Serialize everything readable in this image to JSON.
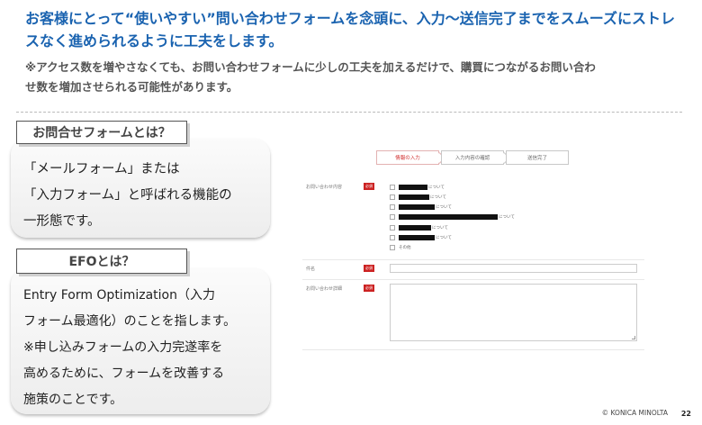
{
  "headline": [
    "お客様にとって“使いやすい”問い合わせフォームを念頭に、入力～送信完了までをスムーズにストレ",
    "スなく進められるように工夫をします。"
  ],
  "subline": [
    "※アクセス数を増やさなくても、お問い合わせフォームに少しの工夫を加えるだけで、購買につながるお問い合わ",
    "せ数を増加させられる可能性があります。"
  ],
  "sections": [
    {
      "label": "お問合せフォームとは？",
      "lines": [
        "「メールフォーム」または",
        "「入力フォーム」と呼ばれる機能の",
        "一形態です。"
      ]
    },
    {
      "label": "EFOとは？",
      "lines": [
        "Entry Form Optimization（入力",
        "フォーム最適化）のことを指します。",
        "※申し込みフォームの入力完遂率を",
        "高めるために、フォームを改善する",
        "施策のことです。"
      ]
    }
  ],
  "form": {
    "steps": [
      "情報の入力",
      "入力内容の確認",
      "送信完了"
    ],
    "required_badge": "必須",
    "field_labels": [
      "お問い合わせ内容",
      "件名",
      "お問い合わせ詳細"
    ],
    "checkbox_suffixes": [
      "について",
      "について",
      "について",
      "について",
      "について",
      "について",
      "その他"
    ]
  },
  "footer": {
    "logo": "© KONICA MINOLTA",
    "page": "22"
  }
}
